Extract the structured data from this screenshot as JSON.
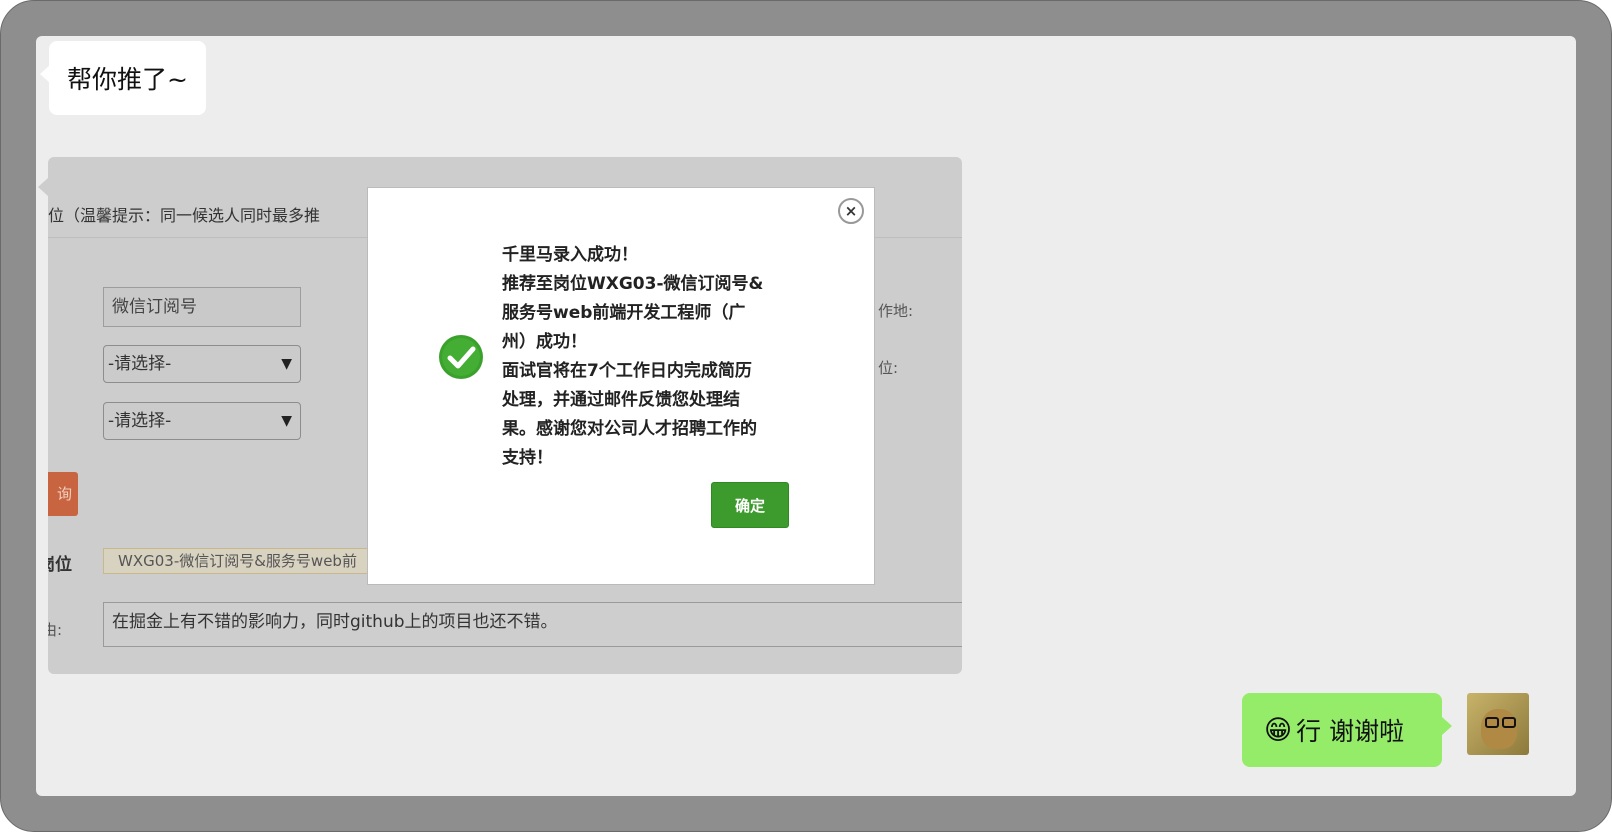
{
  "chat": {
    "incoming_message": "帮你推了~",
    "outgoing_emoji": "😁",
    "outgoing_message": "行  谢谢啦"
  },
  "background_form": {
    "header_text": "位（温馨提示：同一候选人同时最多推",
    "channel_input_value": "微信订阅号",
    "select1_value": "-请选择-",
    "select2_value": "-请选择-",
    "colon_label": ":",
    "workplace_label": "作地:",
    "position_label_right": "位:",
    "red_button_label": "询",
    "position_label": "岗位",
    "position_tag": "WXG03-微信订阅号&服务号web前",
    "reason_label": "由:",
    "reason_text": "在掘金上有不错的影响力，同时github上的项目也还不错。"
  },
  "modal": {
    "close_glyph": "×",
    "message_lines": [
      "千里马录入成功！",
      "推荐至岗位WXG03-微信订阅号&",
      "服务号web前端开发工程师（广",
      "州）成功！",
      "面试官将在7个工作日内完成简历",
      "处理，并通过邮件反馈您处理结",
      "果。感谢您对公司人才招聘工作的",
      "支持！"
    ],
    "ok_label": "确定"
  },
  "colors": {
    "outgoing_bubble": "#94ec69",
    "ok_button": "#3d9a2d",
    "success_icon": "#3aa12c"
  }
}
